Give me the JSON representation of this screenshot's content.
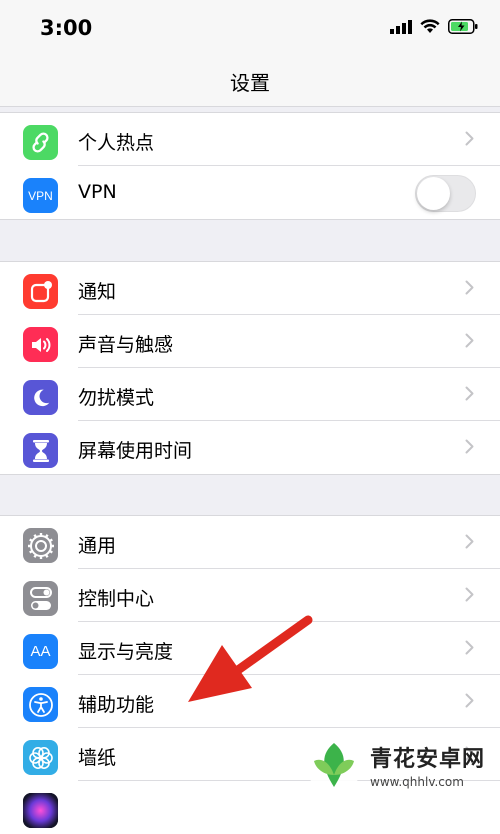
{
  "status": {
    "time": "3:00"
  },
  "nav": {
    "title": "设置"
  },
  "group1": [
    {
      "label": "个人热点",
      "icon": "hotspot-icon",
      "color": "#4cd964",
      "type": "chevron"
    },
    {
      "label": "VPN",
      "icon": "vpn-icon",
      "icon_text": "VPN",
      "color": "#1a82fb",
      "type": "toggle",
      "enabled": false
    }
  ],
  "group2": [
    {
      "label": "通知",
      "icon": "notifications-icon",
      "color": "#ff3b30"
    },
    {
      "label": "声音与触感",
      "icon": "sounds-icon",
      "color": "#ff2d55"
    },
    {
      "label": "勿扰模式",
      "icon": "moon-icon",
      "color": "#5856d6"
    },
    {
      "label": "屏幕使用时间",
      "icon": "hourglass-icon",
      "color": "#5856d6"
    }
  ],
  "group3": [
    {
      "label": "通用",
      "icon": "gear-icon",
      "color": "#8e8e93"
    },
    {
      "label": "控制中心",
      "icon": "switches-icon",
      "color": "#8e8e93"
    },
    {
      "label": "显示与亮度",
      "icon": "display-icon",
      "icon_text": "AA",
      "color": "#1a82fb"
    },
    {
      "label": "辅助功能",
      "icon": "accessibility-icon",
      "color": "#1a82fb"
    },
    {
      "label": "墙纸",
      "icon": "wallpaper-icon",
      "color": "#32ade6"
    },
    {
      "label": "",
      "icon": "siri-icon",
      "color": "#2a1f4f"
    }
  ],
  "watermark": {
    "name": "青花安卓网",
    "url": "www.qhhlv.com"
  },
  "colors": {
    "annotation_arrow": "#e0291f",
    "battery": "#4cd964"
  }
}
